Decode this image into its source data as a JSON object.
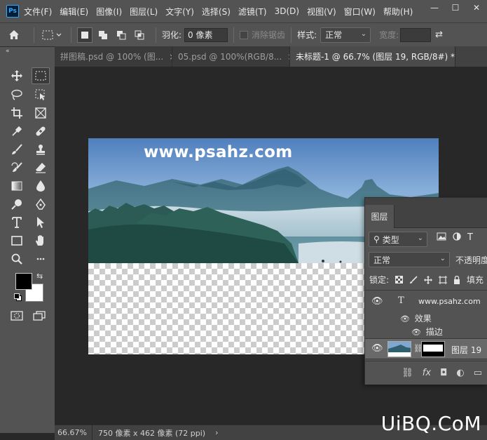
{
  "app": {
    "logo": "Ps",
    "menu": [
      "文件(F)",
      "编辑(E)",
      "图像(I)",
      "图层(L)",
      "文字(Y)",
      "选择(S)",
      "滤镜(T)",
      "3D(D)",
      "视图(V)",
      "窗口(W)",
      "帮助(H)"
    ],
    "window_controls": [
      "—",
      "☐",
      "✕"
    ]
  },
  "options": {
    "feather_label": "羽化:",
    "feather_value": "0 像素",
    "antialias_label": "消除锯齿",
    "style_label": "样式:",
    "style_value": "正常",
    "width_label": "宽度:"
  },
  "tabs": [
    {
      "label": "拼图稿.psd @ 100% (图...",
      "close": "×"
    },
    {
      "label": "05.psd @ 100%(RGB/8...",
      "close": "×"
    },
    {
      "label": "未标题-1 @ 66.7% (图层 19, RGB/8#) *",
      "close": "×"
    }
  ],
  "canvas": {
    "site_text": "www.psahz.com"
  },
  "status": {
    "zoom": "66.67%",
    "doc_info": "750 像素 x 462 像素 (72 ppi)",
    "arrow": "›"
  },
  "layers_panel": {
    "tab_label": "图层",
    "filter_value": "类型",
    "blend_value": "正常",
    "opacity_label": "不透明度",
    "lock_label": "锁定:",
    "fill_label": "填充",
    "text_layer_name": "www.psahz.com",
    "effects_label": "效果",
    "stroke_label": "描边",
    "image_layer_name": "图层 19",
    "footer": [
      "⛓",
      "fx",
      "◘",
      "◐",
      "▭"
    ]
  },
  "watermark": "UiBQ.CoM",
  "icons": {
    "home": "home-icon",
    "marquee": "rect-marquee-icon",
    "eye": "eye-icon"
  },
  "colors": {
    "ui_bg": "#535353",
    "canvas_bg": "#282828",
    "foreground": "#000000",
    "background": "#ffffff"
  }
}
